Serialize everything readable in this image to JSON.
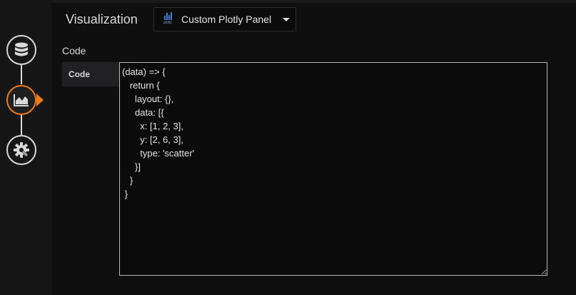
{
  "steps": [
    {
      "icon": "database-icon",
      "state": "inactive"
    },
    {
      "icon": "chart-area-icon",
      "state": "active"
    },
    {
      "icon": "gear-wrench-icon",
      "state": "inactive"
    }
  ],
  "visualization": {
    "title": "Visualization",
    "selected_plugin": "Custom Plotly Panel",
    "logo_text": "plotly"
  },
  "code_section": {
    "label": "Code",
    "tab_label": "Code",
    "value": "(data) => {\n   return {\n     layout: {},\n     data: [{\n       x: [1, 2, 3],\n       y: [2, 6, 3],\n       type: 'scatter'\n     }]\n   }\n }"
  },
  "colors": {
    "accent": "#eb7b18",
    "background": "#0f0f0f",
    "text": "#d8d9da"
  }
}
